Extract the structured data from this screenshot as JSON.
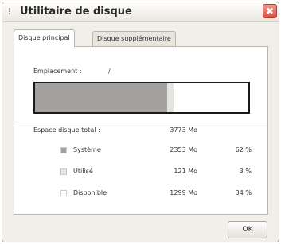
{
  "window": {
    "title": "Utilitaire de disque",
    "close_glyph": "✖"
  },
  "tabs": [
    {
      "label": "Disque principal",
      "active": true
    },
    {
      "label": "Disque supplémentaire",
      "active": false
    }
  ],
  "location": {
    "label": "Emplacement :",
    "value": "/"
  },
  "usage_bar": {
    "system_fraction": 0.62,
    "used_fraction": 0.03,
    "available_fraction": 0.34,
    "colors": {
      "system": "#a3a19e",
      "used": "#e6e4e0",
      "available": "#ffffff"
    }
  },
  "total": {
    "label": "Espace disque total :",
    "value": "3773 Mo"
  },
  "rows": [
    {
      "label": "Système",
      "size": "2353 Mo",
      "percent": "62 %",
      "color": "#a3a19e"
    },
    {
      "label": "Utilisé",
      "size": "121 Mo",
      "percent": "3 %",
      "color": "#e6e4e0"
    },
    {
      "label": "Disponible",
      "size": "1299 Mo",
      "percent": "34 %",
      "color": "#ffffff"
    }
  ],
  "buttons": {
    "ok": "OK"
  }
}
